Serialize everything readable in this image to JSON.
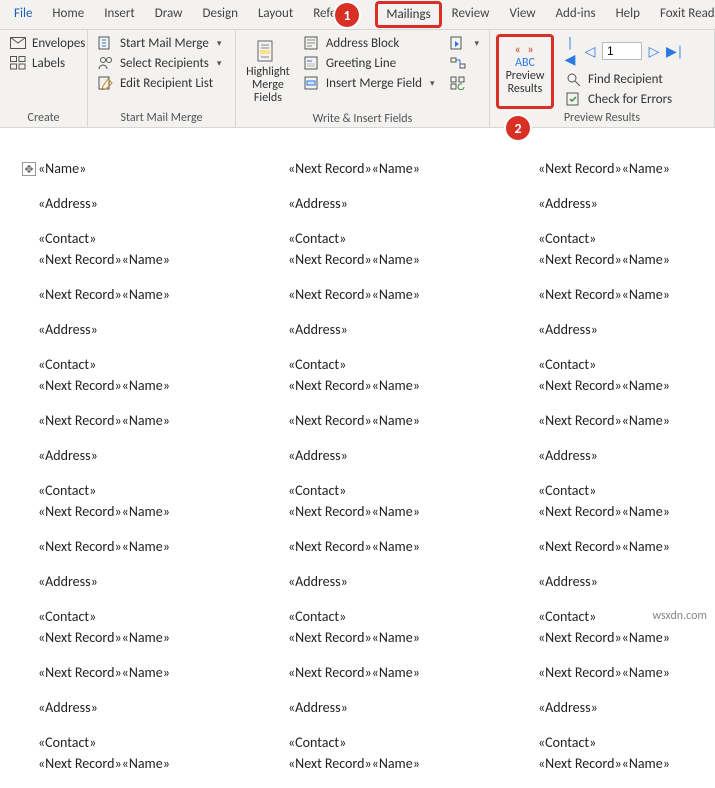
{
  "tabs": {
    "file": "File",
    "home": "Home",
    "insert": "Insert",
    "draw": "Draw",
    "design": "Design",
    "layout": "Layout",
    "references": "Refere",
    "mailings": "Mailings",
    "review": "Review",
    "view": "View",
    "addins": "Add-ins",
    "help": "Help",
    "foxit": "Foxit Reader PD"
  },
  "badges": {
    "one": "1",
    "two": "2"
  },
  "create": {
    "label": "Create",
    "envelopes": "Envelopes",
    "labels": "Labels"
  },
  "startmm": {
    "label": "Start Mail Merge",
    "start": "Start Mail Merge",
    "select": "Select Recipients",
    "edit": "Edit Recipient List"
  },
  "write": {
    "label": "Write & Insert Fields",
    "highlight": "Highlight Merge Fields",
    "addressblock": "Address Block",
    "greeting": "Greeting Line",
    "insertmf": "Insert Merge Field"
  },
  "preview": {
    "label": "Preview Results",
    "abc": "ABC",
    "previewresults": "Preview Results",
    "findrecipient": "Find Recipient",
    "checkerrors": "Check for Errors",
    "record": "1"
  },
  "fields": {
    "name": "«Name»",
    "address": "«Address»",
    "contact": "«Contact»",
    "nextrecord_name": "«Next Record»«Name»"
  },
  "watermark": "wsxdn.com"
}
